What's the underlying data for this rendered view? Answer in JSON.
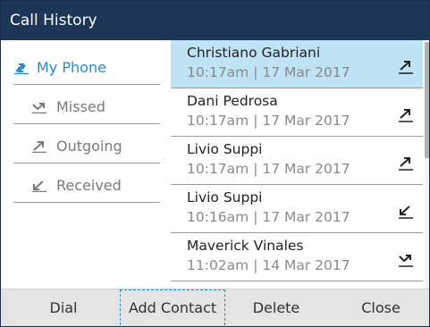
{
  "title": "Call History",
  "sidebar": {
    "items": [
      {
        "label": "My Phone",
        "icon": "all-calls-icon",
        "active": true
      },
      {
        "label": "Missed",
        "icon": "missed-call-icon",
        "active": false
      },
      {
        "label": "Outgoing",
        "icon": "outgoing-call-icon",
        "active": false
      },
      {
        "label": "Received",
        "icon": "received-call-icon",
        "active": false
      }
    ]
  },
  "calls": [
    {
      "name": "Christiano Gabriani",
      "time": "10:17am | 17 Mar 2017",
      "type": "outgoing",
      "selected": true
    },
    {
      "name": "Dani Pedrosa",
      "time": "10:17am | 17 Mar 2017",
      "type": "outgoing",
      "selected": false
    },
    {
      "name": "Livio Suppi",
      "time": "10:17am | 17 Mar 2017",
      "type": "outgoing",
      "selected": false
    },
    {
      "name": "Livio Suppi",
      "time": "10:16am | 17 Mar 2017",
      "type": "received",
      "selected": false
    },
    {
      "name": "Maverick Vinales",
      "time": "11:02am | 14 Mar 2017",
      "type": "missed",
      "selected": false
    }
  ],
  "softkeys": {
    "dial": "Dial",
    "add_contact": "Add Contact",
    "delete": "Delete",
    "close": "Close"
  },
  "colors": {
    "title_bar": "#1d3557",
    "accent": "#2a8ac6",
    "selected_row": "#bde3f5",
    "softkey_bar": "#e4e4e4"
  }
}
